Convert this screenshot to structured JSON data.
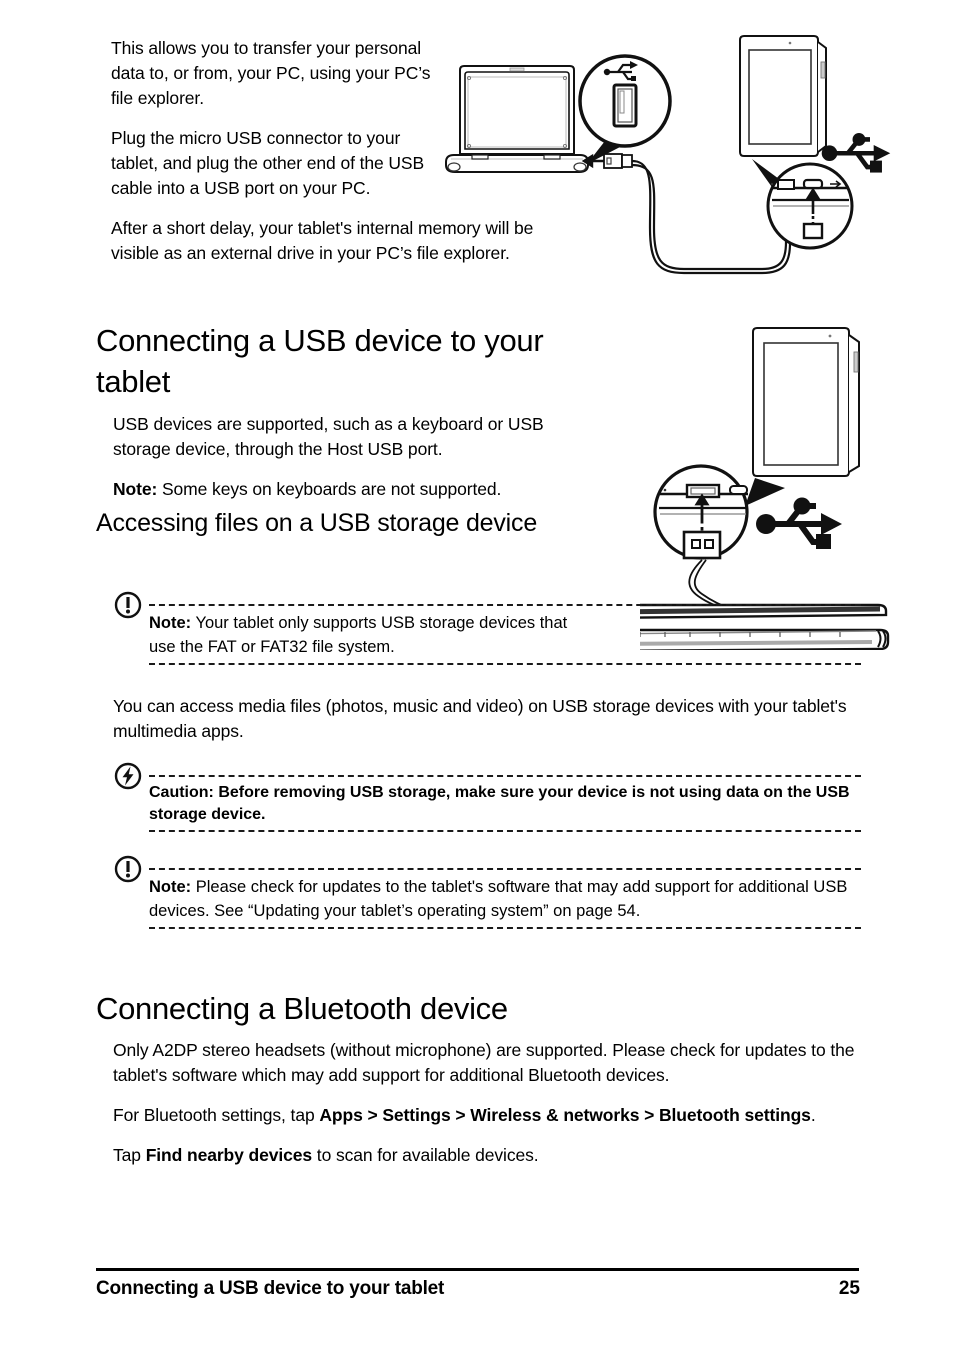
{
  "page": {
    "number": "25",
    "footer_title": "Connecting a USB device to your tablet"
  },
  "intro": {
    "p1": "This allows you to transfer your personal data to, or from, your PC, using your PC’s file explorer.",
    "p2": "Plug the micro USB connector to your tablet, and plug the other end of the USB cable into a USB port on your PC.",
    "p3": "After a short delay, your tablet's internal memory will be visible as an external drive in your PC’s file explorer."
  },
  "section_usb": {
    "heading": "Connecting a USB device to your tablet",
    "p1": "USB devices are supported, such as a keyboard or USB storage device, through the Host USB port.",
    "note_label": "Note:",
    "note_text": " Some keys on keyboards are not supported."
  },
  "subsection_files": {
    "heading": "Accessing files on a USB storage device",
    "note1": {
      "icon": "note-exclamation-icon",
      "label": "Note:",
      "text": " Your tablet only supports USB storage devices that use the FAT or FAT32 file system."
    },
    "p1": "You can access media files (photos, music and video) on USB storage devices with your tablet's multimedia apps.",
    "caution": {
      "icon": "caution-lightning-icon",
      "text": "Caution: Before removing USB storage, make sure your device is not using data on the USB storage device."
    },
    "note2": {
      "icon": "note-exclamation-icon",
      "label": "Note:",
      "text": " Please check for updates to the tablet's software that may add support for additional USB devices. See “Updating your tablet’s operating system” on page 54."
    }
  },
  "section_bluetooth": {
    "heading": "Connecting a Bluetooth device",
    "p1": "Only A2DP stereo headsets (without microphone) are supported. Please check for updates to the tablet's software which may add support for additional Bluetooth devices.",
    "p2_prefix": "For Bluetooth settings, tap ",
    "p2_bold": "Apps > Settings > Wireless & networks > Bluetooth settings",
    "p2_suffix": ".",
    "p3_prefix": "Tap ",
    "p3_bold": "Find nearby devices",
    "p3_suffix": " to scan for available devices."
  },
  "illustration_top": {
    "name": "laptop-to-tablet-usb-diagram",
    "parts": [
      "laptop",
      "usb-port-magnifier",
      "usb-cable",
      "tablet",
      "micro-usb-port-magnifier",
      "usb-logo"
    ]
  },
  "illustration_bottom": {
    "name": "tablet-host-usb-keyboard-diagram",
    "parts": [
      "tablet",
      "host-usb-port-magnifier",
      "usb-logo",
      "keyboard"
    ]
  },
  "colors": {
    "ink": "#000000",
    "paper": "#ffffff",
    "line": "#1a1a1a"
  }
}
